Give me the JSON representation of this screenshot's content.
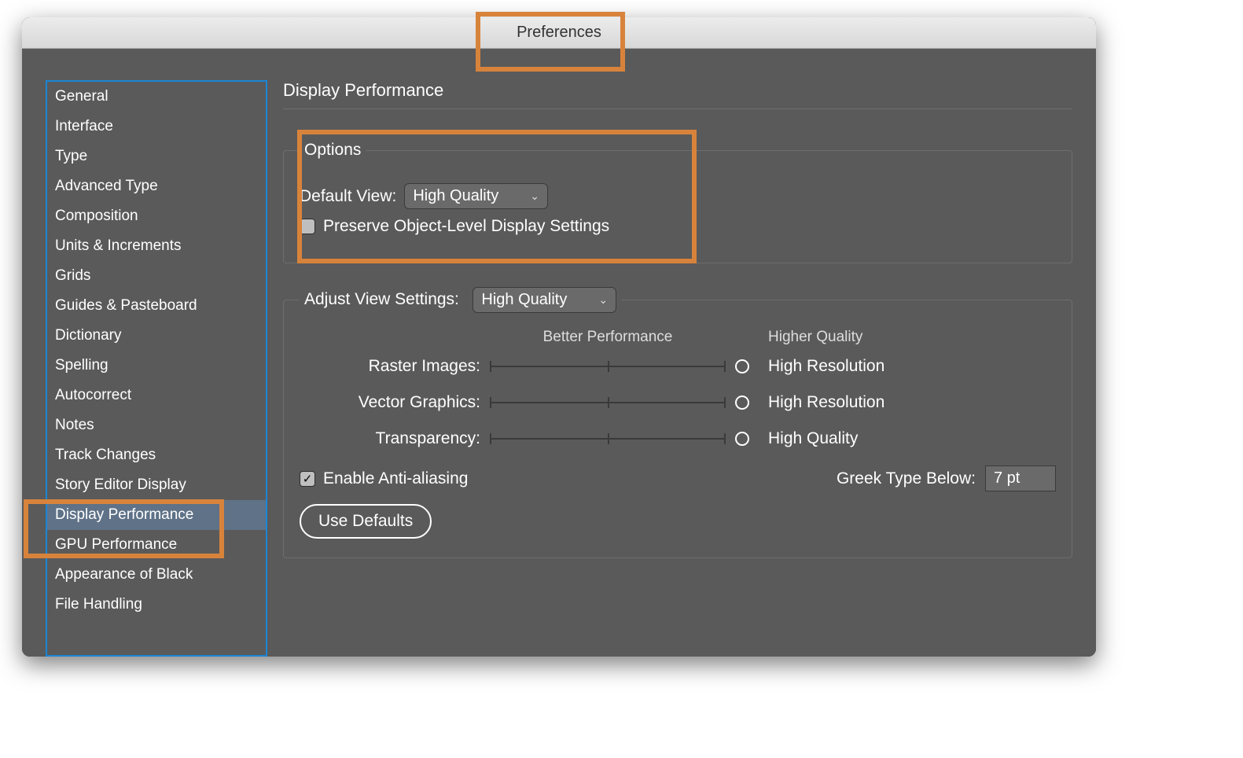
{
  "window": {
    "title": "Preferences"
  },
  "sidebar": {
    "items": [
      {
        "label": "General",
        "selected": false
      },
      {
        "label": "Interface",
        "selected": false
      },
      {
        "label": "Type",
        "selected": false
      },
      {
        "label": "Advanced Type",
        "selected": false
      },
      {
        "label": "Composition",
        "selected": false
      },
      {
        "label": "Units & Increments",
        "selected": false
      },
      {
        "label": "Grids",
        "selected": false
      },
      {
        "label": "Guides & Pasteboard",
        "selected": false
      },
      {
        "label": "Dictionary",
        "selected": false
      },
      {
        "label": "Spelling",
        "selected": false
      },
      {
        "label": "Autocorrect",
        "selected": false
      },
      {
        "label": "Notes",
        "selected": false
      },
      {
        "label": "Track Changes",
        "selected": false
      },
      {
        "label": "Story Editor Display",
        "selected": false
      },
      {
        "label": "Display Performance",
        "selected": true
      },
      {
        "label": "GPU Performance",
        "selected": false
      },
      {
        "label": "Appearance of Black",
        "selected": false
      },
      {
        "label": "File Handling",
        "selected": false
      }
    ]
  },
  "main": {
    "page_title": "Display Performance",
    "options": {
      "legend": "Options",
      "default_view_label": "Default View:",
      "default_view_value": "High Quality",
      "preserve_label": "Preserve Object-Level Display Settings",
      "preserve_checked": false
    },
    "adjust": {
      "legend": "Adjust View Settings:",
      "value": "High Quality",
      "header_left": "Better Performance",
      "header_right": "Higher Quality",
      "sliders": [
        {
          "label": "Raster Images:",
          "value": "High Resolution"
        },
        {
          "label": "Vector Graphics:",
          "value": "High Resolution"
        },
        {
          "label": "Transparency:",
          "value": "High Quality"
        }
      ],
      "antialias_label": "Enable Anti-aliasing",
      "antialias_checked": true,
      "greek_label": "Greek Type Below:",
      "greek_value": "7 pt",
      "defaults_button": "Use Defaults"
    }
  }
}
